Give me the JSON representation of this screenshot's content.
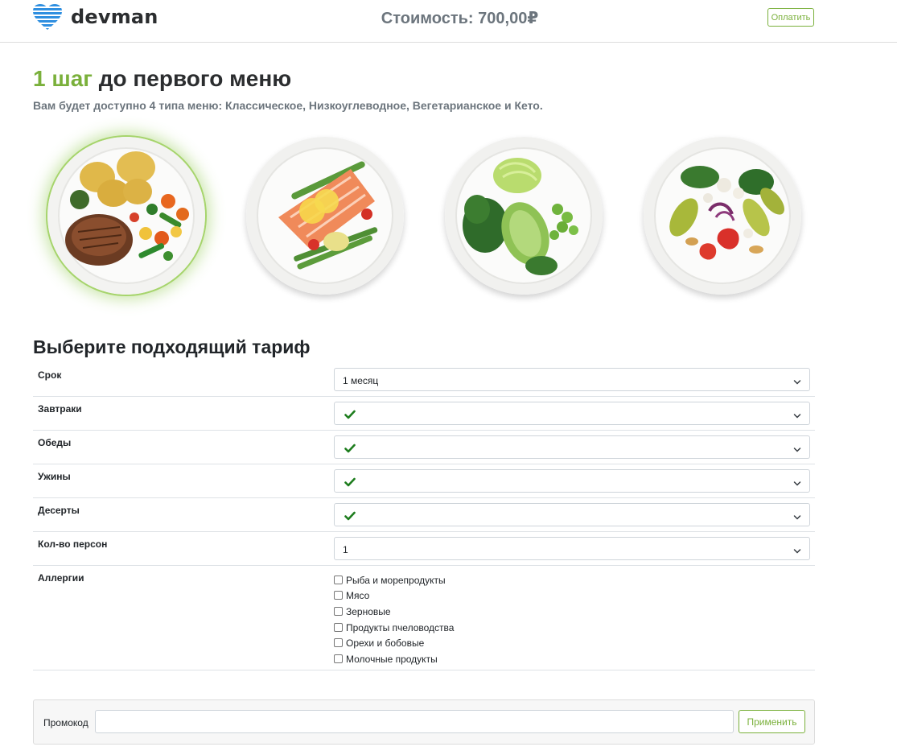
{
  "header": {
    "logo_text": "devman",
    "price": "Стоимость: 700,00₽",
    "pay_label": "Оплатить"
  },
  "intro": {
    "title_accent": "1 шаг",
    "title_rest": " до первого меню",
    "subtitle": "Вам будет доступно 4 типа меню: Классическое, Низкоуглеводное, Вегетарианское и Кето."
  },
  "menus": [
    {
      "name": "classic",
      "selected": true
    },
    {
      "name": "low-carb",
      "selected": false
    },
    {
      "name": "vegetarian",
      "selected": false
    },
    {
      "name": "keto",
      "selected": false
    }
  ],
  "tariff": {
    "title": "Выберите подходящий тариф",
    "rows": [
      {
        "label": "Срок",
        "value": "1 месяц",
        "checked": false
      },
      {
        "label": "Завтраки",
        "value": "",
        "checked": true
      },
      {
        "label": "Обеды",
        "value": "",
        "checked": true
      },
      {
        "label": "Ужины",
        "value": "",
        "checked": true
      },
      {
        "label": "Десерты",
        "value": "",
        "checked": true
      },
      {
        "label": "Кол-во персон",
        "value": "1",
        "checked": false
      }
    ],
    "allergy_label": "Аллергии",
    "allergies": [
      "Рыба и морепродукты",
      "Мясо",
      "Зерновые",
      "Продукты пчеловодства",
      "Орехи и бобовые",
      "Молочные продукты"
    ]
  },
  "promo": {
    "label": "Промокод",
    "input_value": "",
    "apply_label": "Применить"
  },
  "colors": {
    "accent": "#7ab03b",
    "logo_blue": "#2f8fe0",
    "check_green": "#1e7d1e"
  },
  "icons": [
    "heart-logo-icon",
    "check-icon",
    "chevron-down-icon"
  ]
}
